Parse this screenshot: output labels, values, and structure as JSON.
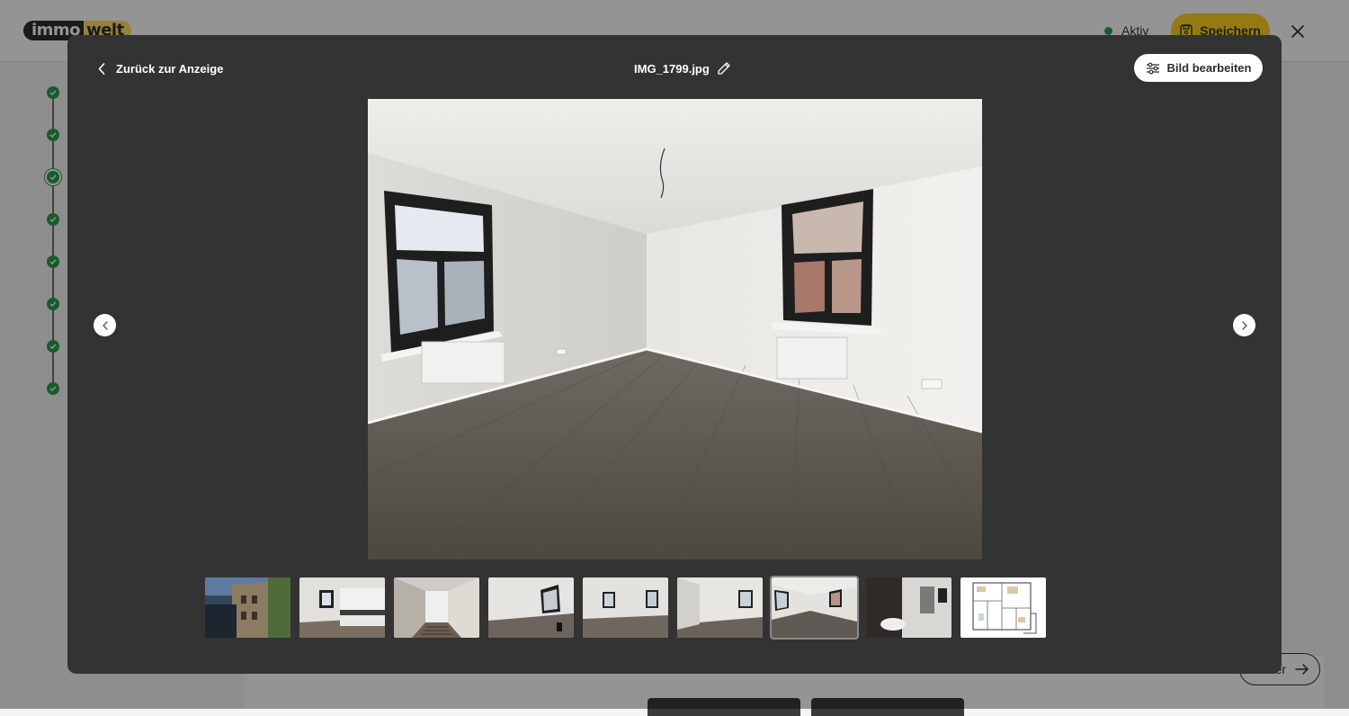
{
  "header": {
    "logo_part1": "immo",
    "logo_part2": "welt",
    "status_label": "Aktiv",
    "status_color": "#2a9d4e",
    "save_label": "Speichern",
    "save_color": "#ffd21f",
    "save_icon": "floppy-disk-icon",
    "close_icon": "close-icon"
  },
  "progress_steps": {
    "count": 8,
    "completed": 8,
    "current_index": 2,
    "icon": "check-icon"
  },
  "footer": {
    "next_label": "Weiter",
    "next_icon": "arrow-right-icon"
  },
  "viewer": {
    "back_label": "Zurück zur Anzeige",
    "back_icon": "chevron-left-icon",
    "file_name": "IMG_1799.jpg",
    "rename_icon": "pencil-icon",
    "edit_label": "Bild bearbeiten",
    "edit_icon": "sliders-icon",
    "prev_icon": "chevron-left-icon",
    "next_icon": "chevron-right-icon",
    "thumbnail_count": 9,
    "active_thumbnail_index": 6
  }
}
